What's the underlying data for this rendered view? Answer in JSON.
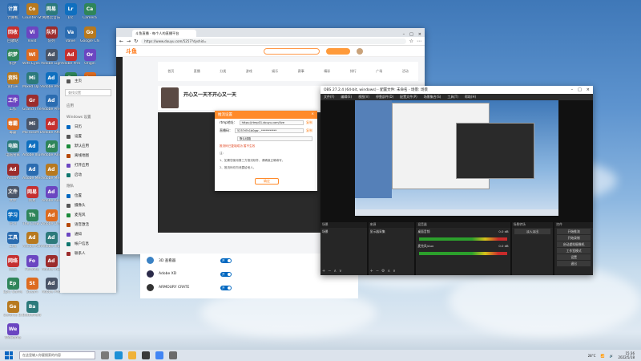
{
  "desktop": {
    "icons_col1": [
      "计算机",
      "回收站",
      "织梦",
      "资料夹",
      "工作",
      "毒霸",
      "电脑管家",
      "Adobe",
      "文件",
      "学习",
      "工具",
      "网络",
      "Epic Games Launcher",
      "Geforce Experience",
      "WeGame"
    ],
    "icons_col2": [
      "Counter-Strike Global Off...",
      "Vivid",
      "Wlfs Eyes Star...",
      "Mixed Up Starlight",
      "Grand Theft Auto V",
      "Microsoft Edge",
      "Adobe Illustrator",
      "Adobe Media...",
      "网易",
      "The Crew 2",
      "Adobe Acrobat",
      "Fortnite",
      "Steam",
      "Battlefield 2042"
    ],
    "icons_col3": [
      "网易云音乐",
      "队列",
      "Adobe Lightroom",
      "Adobe Photoshop",
      "Adobe Premiere Pro",
      "Adobe After Effects",
      "Adobe Animate",
      "Adobe Media Encoder",
      "Adobe Audition",
      "Adobe Dreamweaver",
      "Adobe Illustrator 2022",
      "Adobe InDesign",
      "Adobe Photoshop 2022"
    ],
    "icons_col4": [
      "Lrc",
      "Valve",
      "Adobe Premiere",
      "Prime Video",
      "Thunder",
      "Call and Notifications"
    ],
    "icons_col5": [
      "Camera",
      "Google Chrome",
      "Origin",
      "Logitech G HUB"
    ]
  },
  "browser": {
    "tab_title": "斗鱼直播 - 每个人的直播平台",
    "url": "https://www.douyu.com/5257?dyshid=",
    "site_logo": "斗鱼",
    "nav_items": [
      "首页",
      "直播",
      "分类",
      "游戏",
      "娱乐",
      "赛事",
      "精彩",
      "排行",
      "广场",
      "活动"
    ],
    "streamer_name": "开心又一天不开心又一天"
  },
  "dialog": {
    "title": "推流设置",
    "rtmp_label": "rtmp地址：",
    "rtmp_value": "https://rtmp01.douyu.com/live",
    "rtmp_copy": "复制",
    "key_label": "直播码：",
    "key_value": "5257rEh1b0gw…***********",
    "key_copy": "复制",
    "select_value": "默认线路",
    "warn_text": "推流码已复制成功   暂不生效",
    "note_title": "注：",
    "note_1": "1、如果您使用第三方推流软件，请确保正确填写。",
    "note_2": "2、推流码切勿泄露给他人。",
    "ok_button": "确定"
  },
  "startmenu": {
    "search_placeholder": "查找设置",
    "home": "主页",
    "section": "应用",
    "group_windows": "Windows 设置",
    "items": [
      "日历",
      "设置",
      "默认应用",
      "离线地图",
      "打开应用",
      "启动"
    ],
    "group_privacy": "隐私",
    "items2": [
      "位置",
      "摄像头",
      "麦克风",
      "语音激活",
      "通知",
      "帐户信息",
      "联系人"
    ]
  },
  "settings_list": [
    {
      "name": "3D 查看器",
      "toggle": "开"
    },
    {
      "name": "Adobe XD",
      "toggle": "开"
    },
    {
      "name": "ARMOURY CRATE",
      "toggle": "开"
    }
  ],
  "obs": {
    "title": "OBS 27.2.4 (64-bit, windows) - 配置文件: 未命名 - 场景: 场景",
    "menus": [
      "文件(F)",
      "编辑(E)",
      "视图(V)",
      "停靠部件(D)",
      "配置文件(P)",
      "场景集合(S)",
      "工具(T)",
      "帮助(H)"
    ],
    "preview_label": "未选择源",
    "docks": {
      "scenes": "场景",
      "scene_item": "场景",
      "sources": "来源",
      "source_item": "显示器采集",
      "mixer": "混音器",
      "mixer_ch1": "桌面音频",
      "mixer_ch2": "麦克风/Aux",
      "mixer_db": "0.0 dB",
      "transitions": "场景转场",
      "transition_value": "淡入淡出",
      "controls": "控件",
      "control_buttons": [
        "开始推流",
        "开始录制",
        "启动虚拟摄像机",
        "工作室模式",
        "设置",
        "退出"
      ]
    }
  },
  "taskbar": {
    "search_placeholder": "在这里输入你要搜索的内容",
    "weather": "28°C",
    "time": "15:36",
    "date": "2022/5/18"
  },
  "colors": {
    "accent": "#ff8a2a",
    "obs_bg": "#1d1d1d",
    "toggle_on": "#0067c0"
  }
}
